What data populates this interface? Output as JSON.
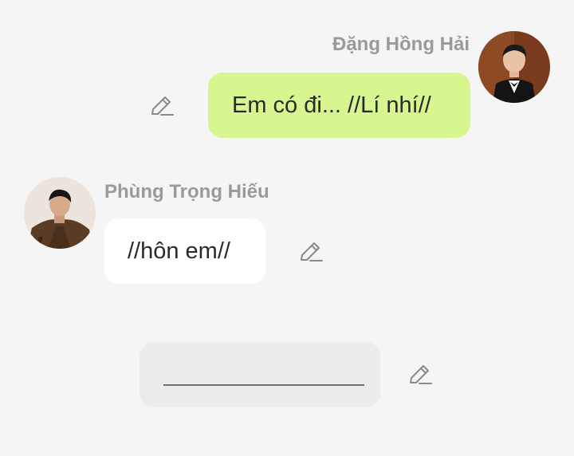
{
  "messages": [
    {
      "sender": "Đặng Hồng Hải",
      "text": "Em có đi... //Lí nhí//",
      "side": "right",
      "bubble_color": "#d7f68f"
    },
    {
      "sender": "Phùng Trọng Hiếu",
      "text": "//hôn em//",
      "side": "left",
      "bubble_color": "#ffffff"
    }
  ],
  "answer_field": {
    "value": ""
  },
  "icons": {
    "edit": "pencil-edit-icon"
  },
  "colors": {
    "background": "#f5f5f5",
    "name_text": "#9a9a9a",
    "icon": "#8a8a8a",
    "input_box": "#ececec"
  }
}
